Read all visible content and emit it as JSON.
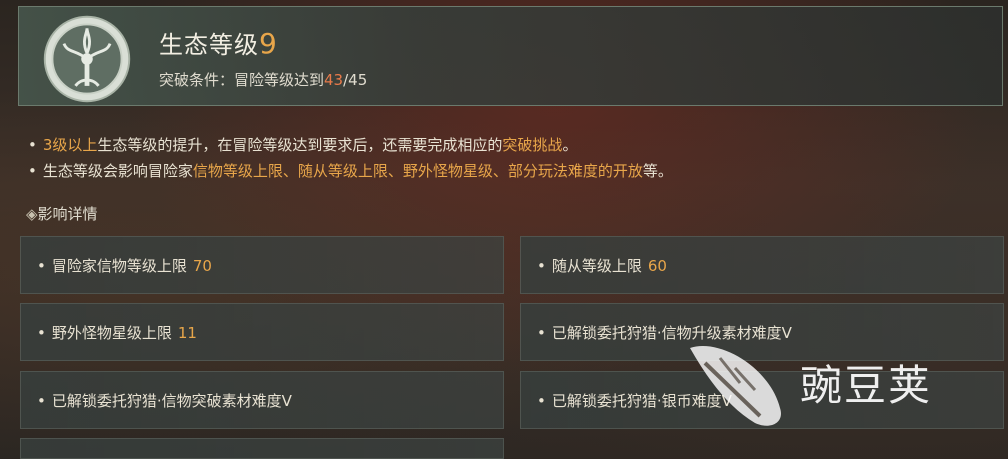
{
  "header": {
    "title": "生态等级",
    "level": "9",
    "condition_label": "突破条件：冒险等级达到",
    "condition_current": "43",
    "condition_total": "/45"
  },
  "notes": [
    {
      "p1": "3级以上",
      "p2": "生态等级的提升，在冒险等级达到要求后，还需要完成相应的",
      "p3": "突破挑战",
      "p4": "。"
    },
    {
      "p1": "生态等级会影响冒险家",
      "p2": "信物等级上限、随从等级上限、野外怪物星级、部分玩法难度的开放",
      "p3": "等。"
    }
  ],
  "section_title": "影响详情",
  "cards": [
    {
      "label": "冒险家信物等级上限",
      "value": "70"
    },
    {
      "label": "随从等级上限",
      "value": "60"
    },
    {
      "label": "野外怪物星级上限",
      "value": "11"
    },
    {
      "label": "已解锁委托狩猎·信物升级素材难度V",
      "value": ""
    },
    {
      "label": "已解锁委托狩猎·信物突破素材难度V",
      "value": ""
    },
    {
      "label": "已解锁委托狩猎·银币难度V",
      "value": ""
    }
  ],
  "watermark": {
    "text": "豌豆荚"
  },
  "colors": {
    "accent": "#e8a64a",
    "current": "#e87a4a"
  }
}
